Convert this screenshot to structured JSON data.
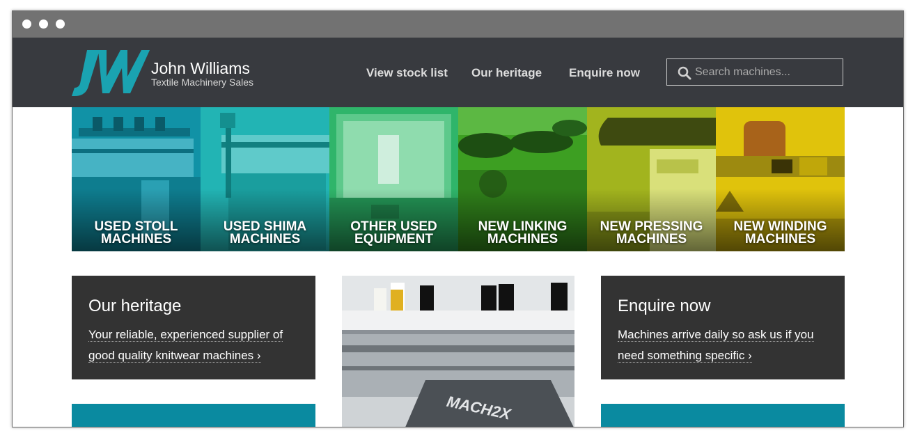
{
  "browser": {
    "dots": 3
  },
  "header": {
    "logo": {
      "mark": "JW",
      "name": "John Williams",
      "tagline": "Textile Machinery Sales",
      "color": "#1aa3b1"
    },
    "nav": [
      "View stock list",
      "Our heritage",
      "Enquire now"
    ],
    "search": {
      "placeholder": "Search machines...",
      "value": ""
    }
  },
  "tiles": [
    {
      "line1": "USED STOLL",
      "line2": "MACHINES",
      "color": "#1192a6"
    },
    {
      "line1": "USED SHIMA",
      "line2": "MACHINES",
      "color": "#22b4b4"
    },
    {
      "line1": "OTHER USED",
      "line2": "EQUIPMENT",
      "color": "#2fb56a"
    },
    {
      "line1": "NEW LINKING",
      "line2": "MACHINES",
      "color": "#3d9f22"
    },
    {
      "line1": "NEW PRESSING",
      "line2": "MACHINES",
      "color": "#a2b41e"
    },
    {
      "line1": "NEW WINDING",
      "line2": "MACHINES",
      "color": "#e0c30c"
    }
  ],
  "cards": [
    {
      "title": "Our heritage",
      "line1": "Your reliable, experienced supplier of",
      "line2": "good quality knitwear machines ›"
    },
    {
      "title": "Enquire now",
      "line1": "Machines arrive daily so ask us if you",
      "line2": "need something specific ›"
    }
  ],
  "photo": {
    "label": "MACH2X"
  },
  "colors": {
    "header_bg": "#383a3f",
    "card_bg": "#333333",
    "accent_teal": "#0a8aa0"
  }
}
